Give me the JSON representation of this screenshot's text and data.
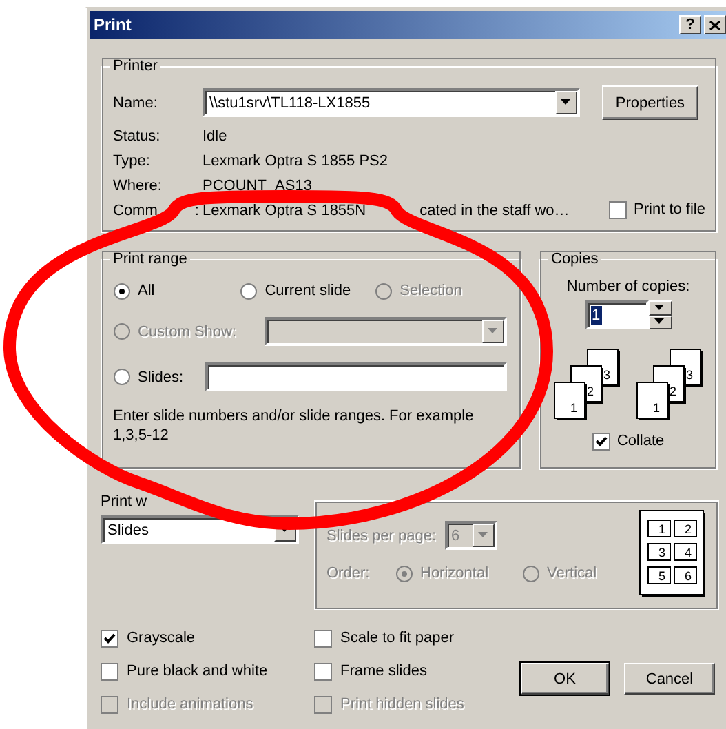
{
  "window": {
    "title": "Print",
    "help_button": "?"
  },
  "printer": {
    "title": "Printer",
    "name_label": "Name:",
    "name_value": "\\\\stu1srv\\TL118-LX1855",
    "properties_button": "Properties",
    "info": [
      {
        "label": "Status:",
        "value": "Idle"
      },
      {
        "label": "Type:",
        "value": "Lexmark Optra S 1855 PS2"
      },
      {
        "label": "Where:",
        "value": "PCOUNT_AS13"
      },
      {
        "label": "Comm",
        "label_tail": ":",
        "value": "Lexmark Optra S 1855N",
        "value_tail": "cated in the staff wo…"
      }
    ],
    "print_to_file": {
      "label": "Print to file",
      "checked": false
    }
  },
  "print_range": {
    "title": "Print range",
    "options": [
      {
        "kind": "plain",
        "label": "All",
        "selected": true,
        "disabled": false
      },
      {
        "kind": "plain",
        "label": "Current slide",
        "selected": false,
        "disabled": false
      },
      {
        "kind": "plain",
        "label": "Selection",
        "selected": false,
        "disabled": true
      },
      {
        "kind": "dropdown",
        "label": "Custom Show:",
        "selected": false,
        "disabled": true
      },
      {
        "kind": "field",
        "label": "Slides:",
        "selected": false,
        "disabled": false
      }
    ],
    "hint": "Enter slide numbers and/or slide ranges. For example 1,3,5-12"
  },
  "copies": {
    "title": "Copies",
    "label": "Number of copies:",
    "value": "1",
    "stacks": [
      [
        "1",
        "2",
        "3"
      ],
      [
        "1",
        "2",
        "3"
      ]
    ],
    "collate": {
      "label": "Collate",
      "checked": true
    }
  },
  "print_what": {
    "label": "Print w",
    "value": "Slides"
  },
  "handouts": {
    "disabled": true,
    "per_page_label": "Slides per page:",
    "per_page_value": "6",
    "order_label": "Order:",
    "orders": [
      {
        "label": "Horizontal",
        "selected": true
      },
      {
        "label": "Vertical",
        "selected": false
      }
    ],
    "preview": [
      "1",
      "2",
      "3",
      "4",
      "5",
      "6"
    ]
  },
  "options": [
    {
      "label": "Grayscale",
      "checked": true,
      "disabled": false
    },
    {
      "label": "Pure black and white",
      "checked": false,
      "disabled": false
    },
    {
      "label": "Include animations",
      "checked": false,
      "disabled": true
    },
    {
      "label": "Scale to fit paper",
      "checked": false,
      "disabled": false
    },
    {
      "label": "Frame slides",
      "checked": false,
      "disabled": false
    },
    {
      "label": "Print hidden slides",
      "checked": false,
      "disabled": true
    }
  ],
  "buttons": [
    {
      "label": "OK",
      "default": true
    },
    {
      "label": "Cancel",
      "default": false
    }
  ],
  "annotations": [
    {
      "kind": "ellipse",
      "color": "#ff0000"
    }
  ]
}
